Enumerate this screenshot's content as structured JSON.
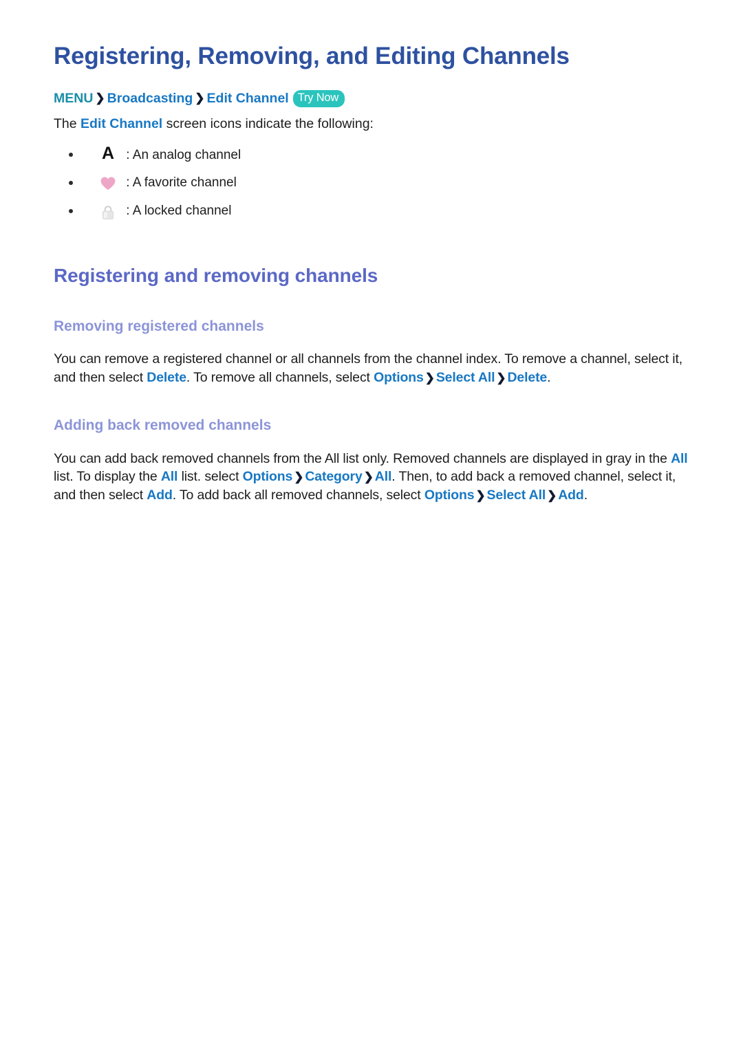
{
  "document": {
    "title": "Registering, Removing, and Editing Channels"
  },
  "breadcrumb": {
    "root": "MENU",
    "separator": "❯",
    "items": [
      "Broadcasting",
      "Edit Channel"
    ],
    "badge": "Try Now"
  },
  "intro": {
    "before": "The ",
    "keyword": "Edit Channel",
    "after": " screen icons indicate the following:"
  },
  "icon_legend": [
    {
      "icon": "analog-channel-letter-a-icon",
      "glyph": "A",
      "text": ": An analog channel"
    },
    {
      "icon": "favorite-channel-heart-icon",
      "glyph": "♥",
      "text": ": A favorite channel"
    },
    {
      "icon": "locked-channel-padlock-icon",
      "glyph": "🔒",
      "text": ": A locked channel"
    }
  ],
  "sections": [
    {
      "heading": "Registering and removing channels",
      "subsections": [
        {
          "heading": "Removing registered channels",
          "paragraph": {
            "p1": "You can remove a registered channel or all channels from the channel index. To remove a channel, select it, and then select ",
            "k1": "Delete",
            "p2": ". To remove all channels, select ",
            "k2": "Options",
            "s1": "❯",
            "k3": "Select All",
            "s2": "❯",
            "k4": "Delete",
            "p3": "."
          }
        },
        {
          "heading": "Adding back removed channels",
          "paragraph": {
            "p1": "You can add back removed channels from the All list only. Removed channels are displayed in gray in the ",
            "k1": "All",
            "p2": " list. To display the ",
            "k2": "All",
            "p3": " list. select ",
            "k3": "Options",
            "s1": "❯",
            "k4": "Category",
            "s2": "❯",
            "k5": "All",
            "p4": ". Then, to add back a removed channel, select it, and then select ",
            "k6": "Add",
            "p5": ". To add back all removed channels, select ",
            "k7": "Options",
            "s3": "❯",
            "k8": "Select All",
            "s4": "❯",
            "k9": "Add",
            "p6": "."
          }
        }
      ]
    }
  ],
  "colors": {
    "title": "#2e51a0",
    "h2": "#5b68c6",
    "h3": "#8c94d8",
    "keyword_link": "#1878c4",
    "menu_root": "#1a8fa8",
    "badge_bg": "#2bc4bd",
    "heart": "#eda6c8",
    "lock": "#dcdcdc",
    "body_text": "#1d1d1d"
  }
}
